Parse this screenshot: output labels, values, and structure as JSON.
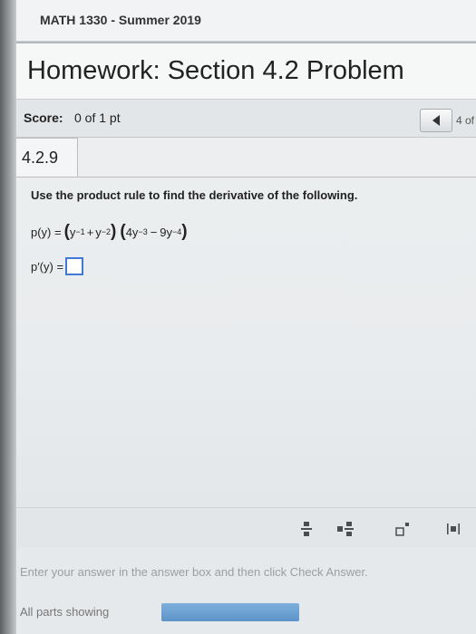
{
  "course": {
    "title": "MATH 1330 - Summer 2019"
  },
  "homework": {
    "title": "Homework: Section 4.2 Problem"
  },
  "score": {
    "label": "Score:",
    "value": "0 of 1 pt"
  },
  "navigation": {
    "page_count": "4 of"
  },
  "question": {
    "number": "4.2.9",
    "instructions": "Use the product rule to find the derivative of the following.",
    "function_lhs": "p(y) =",
    "term1_a": "y",
    "term1_a_exp": "−1",
    "term1_op": "+",
    "term1_b": "y",
    "term1_b_exp": "−2",
    "term2_coef_a": "4y",
    "term2_a_exp": "−3",
    "term2_op": "−",
    "term2_coef_b": "9y",
    "term2_b_exp": "−4",
    "derivative_lhs": "p′(y) =",
    "answer_value": ""
  },
  "toolbar": {
    "tools": [
      {
        "icon": "fraction-icon"
      },
      {
        "icon": "mixed-number-icon"
      },
      {
        "icon": "exponent-icon"
      },
      {
        "icon": "absolute-value-icon"
      }
    ]
  },
  "footer": {
    "hint": "Enter your answer in the answer box and then click Check Answer.",
    "parts_label": "All parts showing",
    "progress_fraction": 1.0
  },
  "colors": {
    "answer_box_border": "#3f7bd6",
    "progress_fill": "#5c93c9"
  }
}
